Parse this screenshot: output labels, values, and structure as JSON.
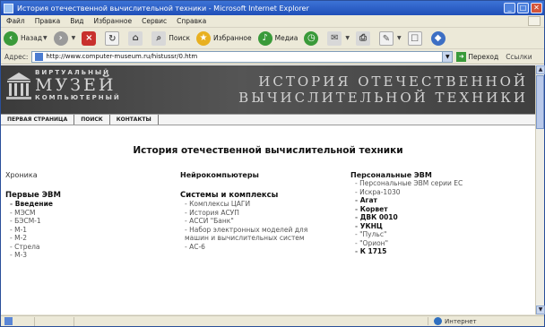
{
  "window": {
    "title": "История отечественной вычислительной техники - Microsoft Internet Explorer",
    "buttons": [
      "_",
      "□",
      "✕"
    ]
  },
  "menubar": {
    "items": [
      "Файл",
      "Правка",
      "Вид",
      "Избранное",
      "Сервис",
      "Справка"
    ]
  },
  "toolbar": {
    "back_label": "Назад",
    "search_label": "Поиск",
    "favorites_label": "Избранное",
    "media_label": "Медиа"
  },
  "addressbar": {
    "label": "Адрес:",
    "url": "http://www.computer-museum.ru/histussr/0.htm",
    "go_label": "Переход",
    "links_label": "Ссылки"
  },
  "site": {
    "logo_top": "ВИРТУАЛЬНЫЙ",
    "logo_main": "МУЗЕЙ",
    "logo_bottom": "КОМПЬЮТЕРНЫЙ",
    "title_line1": "ИСТОРИЯ ОТЕЧЕСТВЕННОЙ",
    "title_line2": "ВЫЧИСЛИТЕЛЬНОЙ ТЕХНИКИ",
    "nav": [
      "ПЕРВАЯ СТРАНИЦА",
      "ПОИСК",
      "КОНТАКТЫ"
    ]
  },
  "page": {
    "heading": "История отечественной вычислительной техники",
    "col1": {
      "head": "Хроника",
      "section": "Первые ЭВМ",
      "items": [
        "Введение",
        "МЭСМ",
        "БЭСМ-1",
        "М-1",
        "М-2",
        "Стрела",
        "М-3"
      ]
    },
    "col2": {
      "head": "Нейрокомпьютеры",
      "section": "Системы и комплексы",
      "items": [
        "Комплексы ЦАГИ",
        "История АСУП",
        "АССИ \"Банк\"",
        "Набор электронных моделей для",
        "машин и вычислительных систем",
        "АС-6"
      ]
    },
    "col3": {
      "head": "Персональные ЭВМ",
      "items": [
        "Персональные ЭВМ серии ЕС",
        "Искра-1030",
        "Агат",
        "Корвет",
        "ДВК 0010",
        "УКНЦ",
        "\"Пульс\"",
        "\"Орион\"",
        "К 1715"
      ]
    }
  },
  "statusbar": {
    "zone": "Интернет"
  }
}
